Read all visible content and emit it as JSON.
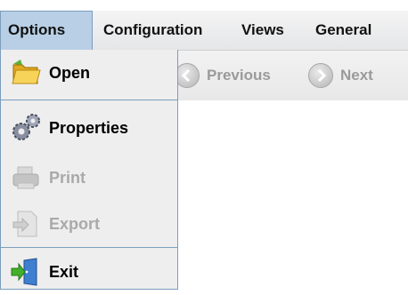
{
  "menubar": {
    "items": [
      {
        "label": "Options",
        "active": true
      },
      {
        "label": "Configuration",
        "active": false
      },
      {
        "label": "Views",
        "active": false
      },
      {
        "label": "General",
        "active": false
      }
    ]
  },
  "toolbar": {
    "previous_label": "Previous",
    "next_label": "Next",
    "previous_icon": "left-arrow-circle-icon",
    "next_icon": "right-arrow-circle-icon"
  },
  "options_menu": {
    "items": [
      {
        "label": "Open",
        "icon": "folder-icon",
        "enabled": true
      },
      {
        "label": "Properties",
        "icon": "gears-icon",
        "enabled": true
      },
      {
        "label": "Print",
        "icon": "printer-icon",
        "enabled": false
      },
      {
        "label": "Export",
        "icon": "export-icon",
        "enabled": false
      },
      {
        "label": "Exit",
        "icon": "exit-door-icon",
        "enabled": true
      }
    ]
  },
  "colors": {
    "menu_active_bg": "#b8cfe5",
    "menu_border": "#7b9ebd",
    "disabled_text": "#a9a9a9"
  }
}
